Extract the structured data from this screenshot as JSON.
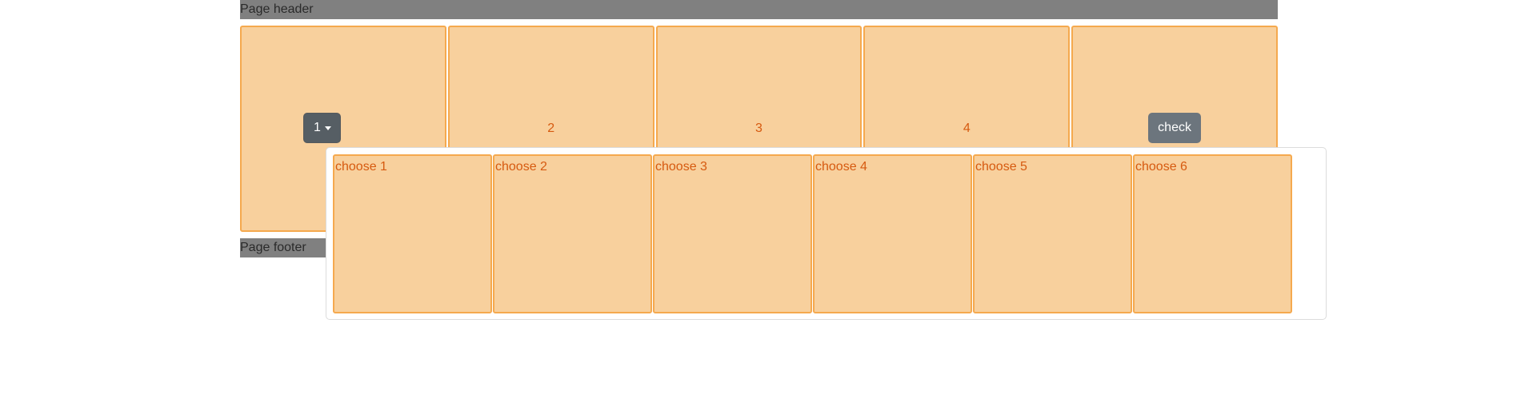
{
  "header": {
    "text": "Page header"
  },
  "footer": {
    "text": "Page footer"
  },
  "cells": {
    "dropdown_label": "1",
    "c2": "2",
    "c3": "3",
    "c4": "4",
    "check_label": "check"
  },
  "menu": {
    "items": [
      "choose 1",
      "choose 2",
      "choose 3",
      "choose 4",
      "choose 5",
      "choose 6"
    ]
  },
  "colors": {
    "cell_bg": "#f8d09d",
    "cell_border": "#f5a94e",
    "cell_text": "#d65a10",
    "header_bg": "#808080",
    "dropdown_btn": "#565e64",
    "check_btn": "#6c757d"
  },
  "icons": {
    "dropdown_caret": "caret-down-icon"
  }
}
